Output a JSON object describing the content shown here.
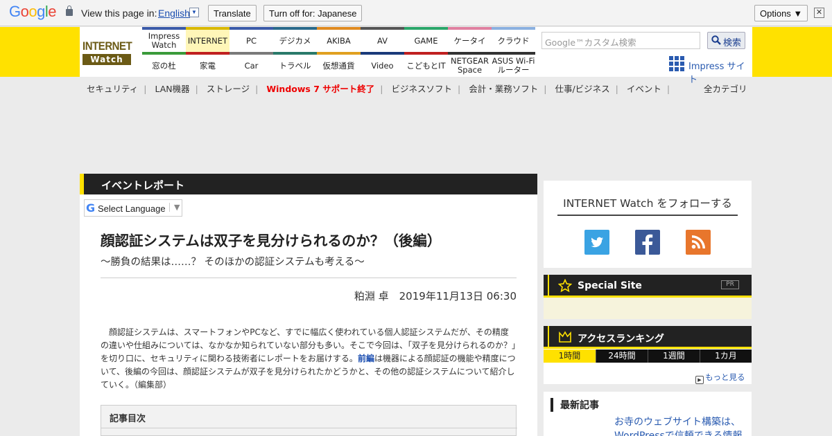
{
  "translate_bar": {
    "brand": "Google",
    "view_text": "View this page in:",
    "language": "English",
    "dropdown_glyph": "▼",
    "translate_button": "Translate",
    "turn_off_button": "Turn off for: Japanese",
    "options_button": "Options ▼",
    "close_glyph": "✕"
  },
  "header": {
    "logo_line1": "INTERNET",
    "logo_line2": "Watch",
    "nav_top": [
      {
        "label": "Impress Watch",
        "color": "#3a5aa8"
      },
      {
        "label": "INTERNET",
        "color": "#d9b800"
      },
      {
        "label": "PC",
        "color": "#3a5aa8"
      },
      {
        "label": "デジカメ",
        "color": "#2a6a8a"
      },
      {
        "label": "AKIBA",
        "color": "#e08a20"
      },
      {
        "label": "AV",
        "color": "#555555"
      },
      {
        "label": "GAME",
        "color": "#2aa66a"
      },
      {
        "label": "ケータイ",
        "color": "#e080a0"
      },
      {
        "label": "クラウド",
        "color": "#8ab0e0"
      }
    ],
    "nav_bottom": [
      {
        "label": "窓の杜",
        "color": "#3a9a3a"
      },
      {
        "label": "家電",
        "color": "#c02020"
      },
      {
        "label": "Car",
        "color": "#7a7a7a"
      },
      {
        "label": "トラベル",
        "color": "#2a7a6a"
      },
      {
        "label": "仮想通貨",
        "color": "#e0a020"
      },
      {
        "label": "Video",
        "color": "#1a3a7a"
      },
      {
        "label": "こどもとIT",
        "color": "#c02020"
      },
      {
        "label": "NETGEAR Space",
        "color": "#333333"
      },
      {
        "label": "ASUS Wi-Fiルーター",
        "color": "#333333"
      }
    ],
    "search_placeholder": "Google™カスタム検索",
    "search_button": "検索",
    "impress_site": "Impress サイト"
  },
  "subnav": {
    "items": [
      "セキュリティ",
      "LAN機器",
      "ストレージ",
      "Windows 7 サポート終了",
      "ビジネスソフト",
      "会計・業務ソフト",
      "仕事/ビジネス",
      "イベント"
    ],
    "highlight_index": 3,
    "all_categories": "全カテゴリ"
  },
  "article": {
    "section": "イベントレポート",
    "select_language": "Select Language",
    "select_glyph": "▼",
    "title": "顔認証システムは双子を見分けられるのか？（後編）",
    "subtitle": "～勝負の結果は……？ そのほかの認証システムも考える～",
    "byline": "粕淵 卓　2019年11月13日 06:30",
    "lead_part1": "顔認証システムは、スマートフォンやPCなど、すでに幅広く使われている個人認証システムだが、その精度の違いや仕組みについては、なかなか知られていない部分も多い。そこで今回は、「双子を見分けられるのか？」を切り口に、セキュリティに関わる技術者にレポートをお届けする。",
    "lead_link": "前編",
    "lead_part2": "は機器による顔認証の機能や精度について、後編の今回は、顔認証システムが双子を見分けられたかどうかと、その他の認証システムについて紹介していく。（編集部）",
    "toc_heading": "記事目次"
  },
  "sidebar": {
    "follow_title": "INTERNET Watch をフォローする",
    "social": [
      {
        "name": "twitter",
        "color": "#3aa3e3",
        "glyph": "🐦"
      },
      {
        "name": "facebook",
        "color": "#3b5998",
        "glyph": "f"
      },
      {
        "name": "rss",
        "color": "#e8762c",
        "glyph": "◉"
      }
    ],
    "special_site": "Special Site",
    "pr_badge": "PR",
    "ranking_title": "アクセスランキング",
    "ranking_tabs": [
      "1時間",
      "24時間",
      "1週間",
      "1カ月"
    ],
    "ranking_active": 0,
    "more": "もっと見る",
    "latest_heading": "最新記事",
    "latest_article": "お寺のウェブサイト構築は、WordPressで信頼できる情報"
  }
}
